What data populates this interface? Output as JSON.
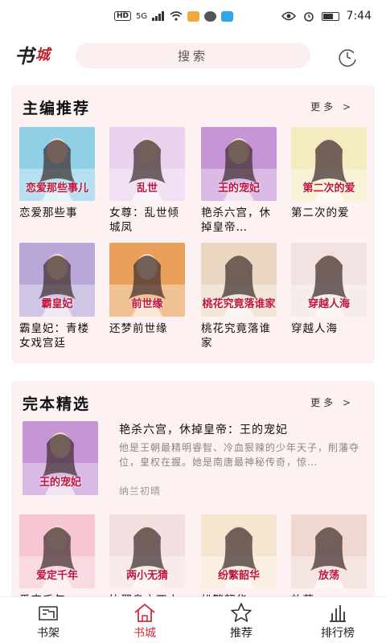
{
  "status_bar": {
    "network": "HD",
    "signal": "5G",
    "time": "7:44"
  },
  "header": {
    "logo_text": "书城",
    "search_placeholder": "搜索"
  },
  "editor_picks": {
    "title": "主编推荐",
    "more_label": "更多 >",
    "books": [
      {
        "title": "恋爱那些事",
        "cover_text": "恋爱那些事儿",
        "color": "#8fd0e6"
      },
      {
        "title": "女尊：乱世倾城凤",
        "cover_text": "乱世",
        "color": "#e8d2ee"
      },
      {
        "title": "艳杀六宫，休掉皇帝…",
        "cover_text": "王的宠妃",
        "color": "#c794d6"
      },
      {
        "title": "第二次的爱",
        "cover_text": "第二次的爱",
        "color": "#f4ecc0"
      },
      {
        "title": "霸皇妃：青楼女戏宫廷",
        "cover_text": "霸皇妃",
        "color": "#b8a7d8"
      },
      {
        "title": "还梦前世缘",
        "cover_text": "前世缘",
        "color": "#e9a05a"
      },
      {
        "title": "桃花究竟落谁家",
        "cover_text": "桃花究竟落谁家",
        "color": "#ead7c2"
      },
      {
        "title": "穿越人海",
        "cover_text": "穿越人海",
        "color": "#f2e2e2"
      }
    ]
  },
  "finished_picks": {
    "title": "完本精选",
    "more_label": "更多 >",
    "featured": {
      "title": "艳杀六宫，休掉皇帝：王的宠妃",
      "description": "他是王朝最精明睿智、冷血狠辣的少年天子，削藩夺位，皇权在握。她是南唐最神秘传奇，惊…",
      "author": "纳兰初晴",
      "cover_text": "王的宠妃",
      "color": "#c794d6"
    },
    "books": [
      {
        "title": "爱定千年",
        "cover_text": "爱定千年",
        "color": "#f6c7d3"
      },
      {
        "title": "比翼鸟之两小无猜",
        "cover_text": "两小无猜",
        "color": "#f3e0e0"
      },
      {
        "title": "纷繁韶华",
        "cover_text": "纷繁韶华",
        "color": "#f7e6cf"
      },
      {
        "title": "放荡",
        "cover_text": "放荡",
        "color": "#f0d7cf"
      }
    ]
  },
  "tab_bar": {
    "tabs": [
      {
        "label": "书架",
        "icon": "bookshelf-icon"
      },
      {
        "label": "书城",
        "icon": "home-icon"
      },
      {
        "label": "推荐",
        "icon": "star-icon"
      },
      {
        "label": "排行榜",
        "icon": "ranking-icon"
      }
    ],
    "active_color": "#d32f3a"
  }
}
